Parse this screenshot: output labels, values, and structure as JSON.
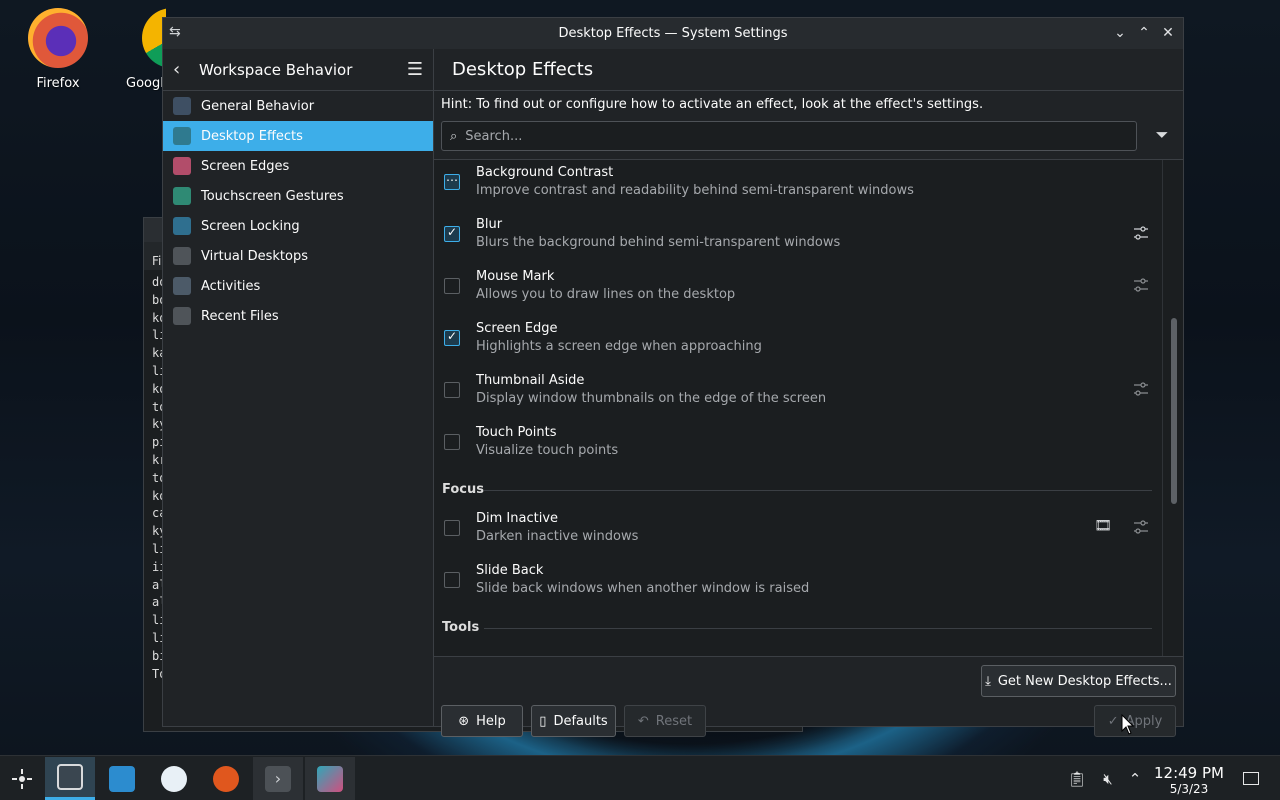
{
  "desktop": {
    "icons": [
      {
        "label": "Firefox",
        "icon": "firefox-icon"
      },
      {
        "label": "Googl",
        "icon": "chrome-icon"
      }
    ]
  },
  "background_terminal": {
    "tab_partial": "Fi",
    "lines": [
      "do",
      "bo",
      "ko",
      "li",
      "ka",
      "li",
      "ko",
      "to",
      "ky",
      "pi",
      "kr",
      "to",
      "ko",
      "ca",
      "ky",
      "li",
      "ii",
      "al",
      "al",
      "li",
      "li",
      "bi",
      "To"
    ]
  },
  "window": {
    "title": "Desktop Effects — System Settings",
    "sidebar": {
      "header": "Workspace Behavior",
      "items": [
        {
          "label": "General Behavior",
          "color": "#3e4f63"
        },
        {
          "label": "Desktop Effects",
          "color": "#2f7a8f"
        },
        {
          "label": "Screen Edges",
          "color": "#b24d6a"
        },
        {
          "label": "Touchscreen Gestures",
          "color": "#2f8a74"
        },
        {
          "label": "Screen Locking",
          "color": "#2f6f8f"
        },
        {
          "label": "Virtual Desktops",
          "color": "#4f5459"
        },
        {
          "label": "Activities",
          "color": "#4c5a68"
        },
        {
          "label": "Recent Files",
          "color": "#4f5459"
        }
      ],
      "active_index": 1
    },
    "content": {
      "title": "Desktop Effects",
      "hint": "Hint: To find out or configure how to activate an effect, look at the effect's settings.",
      "search_placeholder": "Search...",
      "effects_top": [
        {
          "name": "Background Contrast",
          "desc": "Improve contrast and readability behind semi-transparent windows",
          "state": "partial",
          "configurable": false
        },
        {
          "name": "Blur",
          "desc": "Blurs the background behind semi-transparent windows",
          "state": "checked",
          "configurable": true
        },
        {
          "name": "Mouse Mark",
          "desc": "Allows you to draw lines on the desktop",
          "state": "unchecked",
          "configurable": true
        },
        {
          "name": "Screen Edge",
          "desc": "Highlights a screen edge when approaching",
          "state": "checked",
          "configurable": false
        },
        {
          "name": "Thumbnail Aside",
          "desc": "Display window thumbnails on the edge of the screen",
          "state": "unchecked",
          "configurable": true
        },
        {
          "name": "Touch Points",
          "desc": "Visualize touch points",
          "state": "unchecked",
          "configurable": false
        }
      ],
      "section_focus": "Focus",
      "effects_focus": [
        {
          "name": "Dim Inactive",
          "desc": "Darken inactive windows",
          "state": "unchecked",
          "configurable": true,
          "video": true
        },
        {
          "name": "Slide Back",
          "desc": "Slide back windows when another window is raised",
          "state": "unchecked",
          "configurable": false
        }
      ],
      "section_tools": "Tools",
      "get_new_label": "Get New Desktop Effects...",
      "help_label": "Help",
      "defaults_label": "Defaults",
      "reset_label": "Reset",
      "apply_label": "Apply"
    }
  },
  "taskbar": {
    "clock_time": "12:49 PM",
    "clock_date": "5/3/23"
  },
  "colors": {
    "accent": "#3daee9",
    "window_bg": "#202326",
    "list_bg": "#1b1e20"
  }
}
